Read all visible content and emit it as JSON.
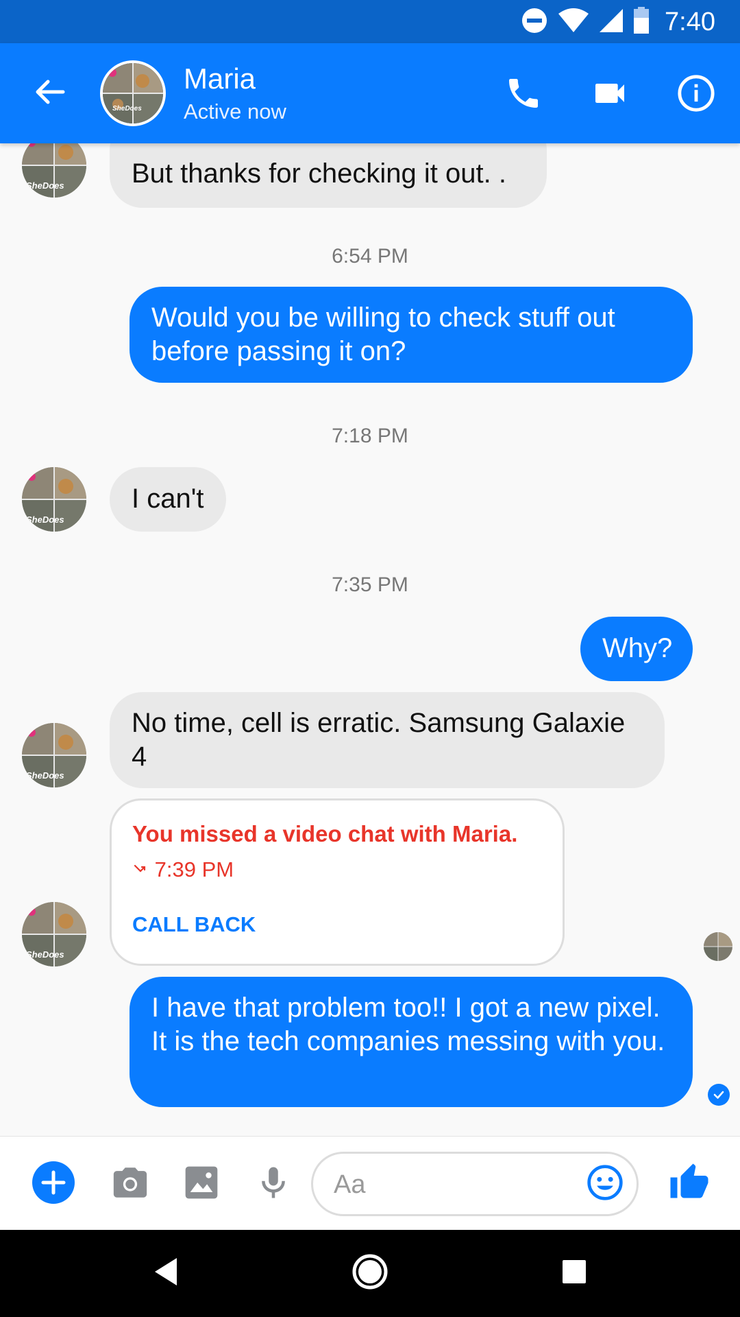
{
  "status_bar": {
    "time": "7:40",
    "icons": [
      "do-not-disturb-icon",
      "wifi-icon",
      "signal-icon",
      "battery-icon"
    ]
  },
  "header": {
    "contact_name": "Maria",
    "contact_status": "Active now",
    "avatar_text": "SheDoes",
    "icons": [
      "back-arrow-icon",
      "phone-icon",
      "video-camera-icon",
      "info-icon"
    ]
  },
  "conversation": {
    "messages": [
      {
        "direction": "incoming",
        "text": "But thanks for checking it out. ."
      },
      {
        "timestamp": "6:54 PM"
      },
      {
        "direction": "outgoing",
        "text": "Would you be willing to check stuff out before passing it on?"
      },
      {
        "timestamp": "7:18 PM"
      },
      {
        "direction": "incoming",
        "text": "I can't"
      },
      {
        "timestamp": "7:35 PM"
      },
      {
        "direction": "outgoing",
        "text": "Why?"
      },
      {
        "direction": "incoming",
        "text": "No time, cell is erratic. Samsung Galaxie 4"
      },
      {
        "direction": "incoming",
        "type": "missed_call"
      },
      {
        "direction": "outgoing",
        "text": "I have that problem too!! I got a new pixel. It is the tech companies messing with you."
      }
    ],
    "missed_call": {
      "title": "You missed a video chat with Maria.",
      "time": "7:39 PM",
      "action_label": "CALL BACK"
    },
    "avatar_text": "SheDoes"
  },
  "composer": {
    "placeholder": "Aa",
    "value": "",
    "icons": [
      "plus-icon",
      "camera-icon",
      "gallery-icon",
      "microphone-icon",
      "emoji-icon",
      "thumbs-up-icon"
    ]
  },
  "colors": {
    "status_bar": "#0b64c8",
    "app_bar": "#0a7cff",
    "outgoing_bubble": "#0a7cff",
    "incoming_bubble": "#e9e9e9",
    "missed_call": "#e8352a",
    "icon_gray": "#8a8d91"
  },
  "nav_bar": {
    "icons": [
      "nav-back-icon",
      "nav-home-icon",
      "nav-recents-icon"
    ]
  }
}
